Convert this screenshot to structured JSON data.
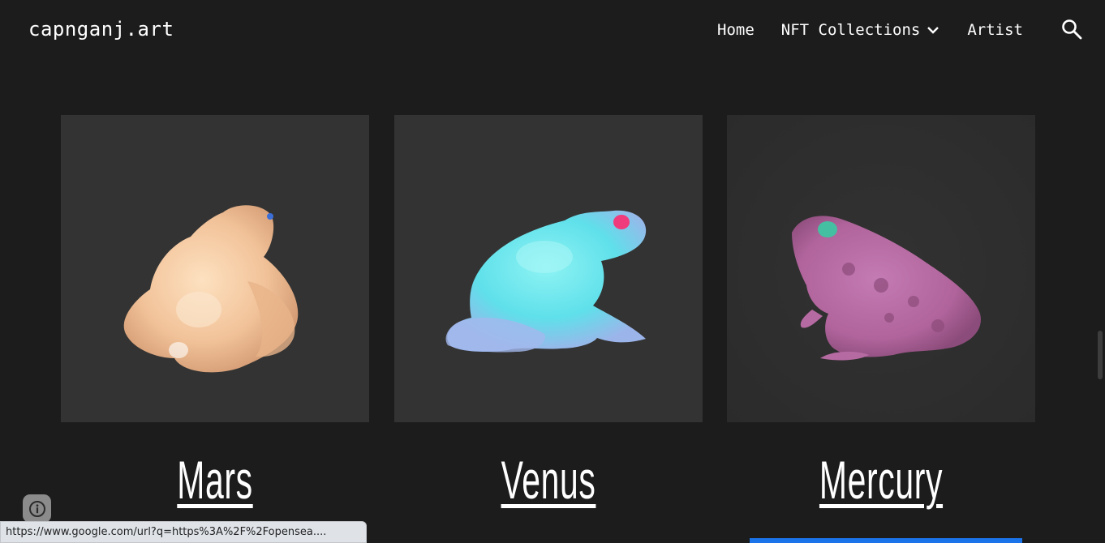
{
  "header": {
    "site_title": "capnganj.art",
    "nav": {
      "home": "Home",
      "collections": "NFT Collections",
      "artist": "Artist"
    },
    "icons": {
      "dropdown": "chevron-down-icon",
      "search": "search-icon"
    }
  },
  "cards": [
    {
      "title": "Mars",
      "image": "orange frog artwork",
      "color": "#f2c79a"
    },
    {
      "title": "Venus",
      "image": "cyan frog artwork",
      "color": "#5fe3ee"
    },
    {
      "title": "Mercury",
      "image": "pink frog artwork",
      "color": "#c06aa5"
    }
  ],
  "status_bar": {
    "url": "https://www.google.com/url?q=https%3A%2F%2Fopensea...."
  },
  "colors": {
    "background": "#1c1c1c",
    "card_background": "#333333",
    "accent_blue": "#1a73e8"
  }
}
